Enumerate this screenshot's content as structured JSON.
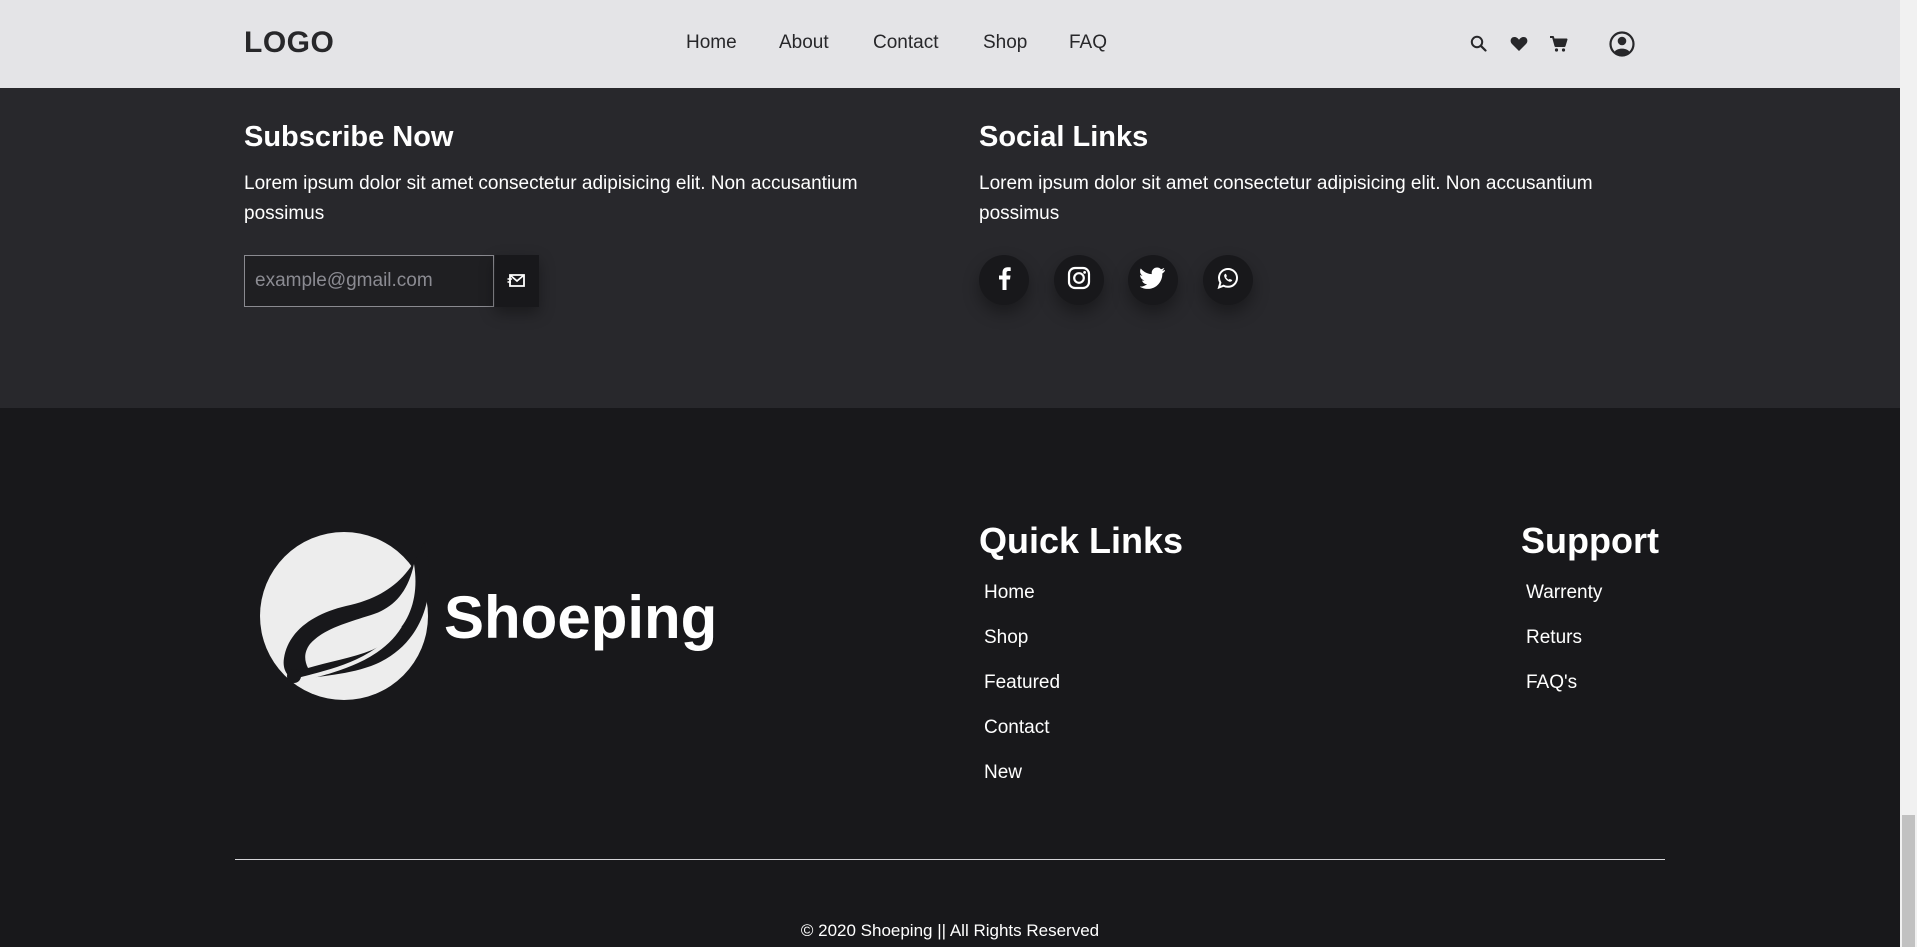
{
  "navbar": {
    "logo": "LOGO",
    "links": [
      "Home",
      "About",
      "Contact",
      "Shop",
      "FAQ"
    ],
    "icons": [
      "search-icon",
      "heart-icon",
      "cart-icon",
      "user-icon"
    ]
  },
  "subscribe": {
    "title": "Subscribe Now",
    "text": "Lorem ipsum dolor sit amet consectetur adipisicing elit. Non accusantium possimus",
    "placeholder": "example@gmail.com",
    "button_icon": "envelope-send-icon"
  },
  "social": {
    "title": "Social Links",
    "text": "Lorem ipsum dolor sit amet consectetur adipisicing elit. Non accusantium possimus",
    "icons": [
      "facebook-icon",
      "instagram-icon",
      "twitter-icon",
      "whatsapp-icon"
    ]
  },
  "footer": {
    "brand": "Shoeping",
    "quick_links": {
      "title": "Quick Links",
      "items": [
        "Home",
        "Shop",
        "Featured",
        "Contact",
        "New"
      ]
    },
    "support": {
      "title": "Support",
      "items": [
        "Warrenty",
        "Returs",
        "FAQ's"
      ]
    },
    "copyright": "© 2020 Shoeping || All Rights Reserved"
  },
  "colors": {
    "navbar_bg": "#e4e4e7",
    "subscribe_bg": "#28282c",
    "footer_bg": "#18181b",
    "text": "#ffffff"
  }
}
